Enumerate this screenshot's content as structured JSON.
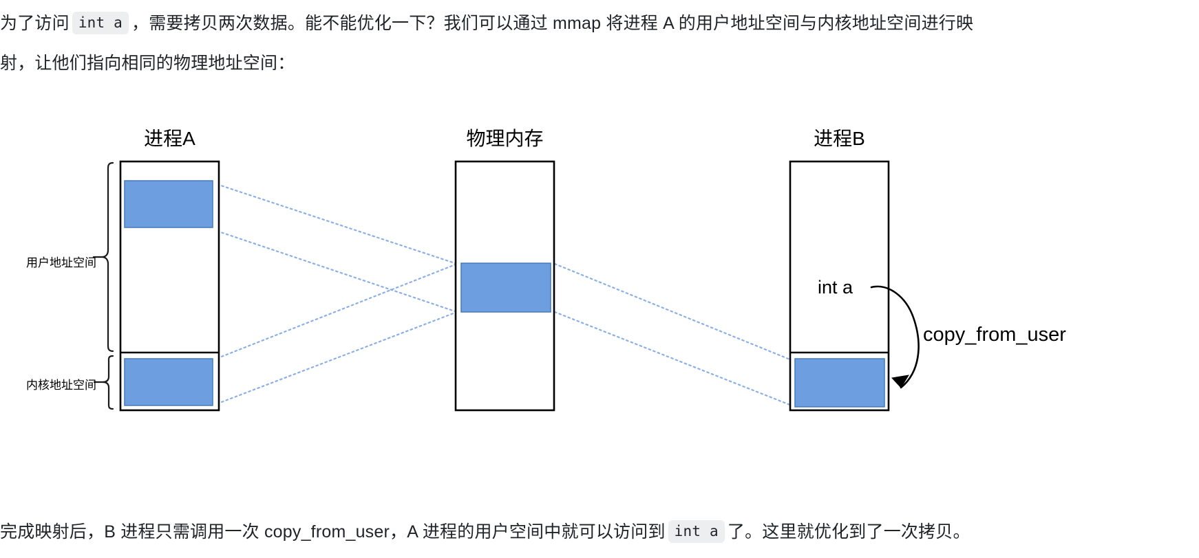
{
  "paragraph_top": {
    "line1_a": "为了访问",
    "code1": "int a",
    "line1_b": "，需要拷贝两次数据。能不能优化一下？我们可以通过 mmap 将进程 A 的用户地址空间与内核地址空间进行映",
    "line2": "射，让他们指向相同的物理地址空间："
  },
  "paragraph_bottom": {
    "text_a": "完成映射后，B 进程只需调用一次 copy_from_user，A 进程的用户空间中就可以访问到",
    "code": "int a",
    "text_b": "了。这里就优化到了一次拷贝。"
  },
  "diagram": {
    "titles": {
      "process_a": "进程A",
      "physical_memory": "物理内存",
      "process_b": "进程B"
    },
    "side_labels": {
      "user_space": "用户地址空间",
      "kernel_space": "内核地址空间"
    },
    "annotations": {
      "int_a": "int a",
      "copy_from_user": "copy_from_user"
    },
    "colors": {
      "block_fill": "#6D9EE0",
      "block_stroke": "#4a7ebb",
      "box_stroke": "#000000",
      "connector": "#8aaee8"
    }
  }
}
